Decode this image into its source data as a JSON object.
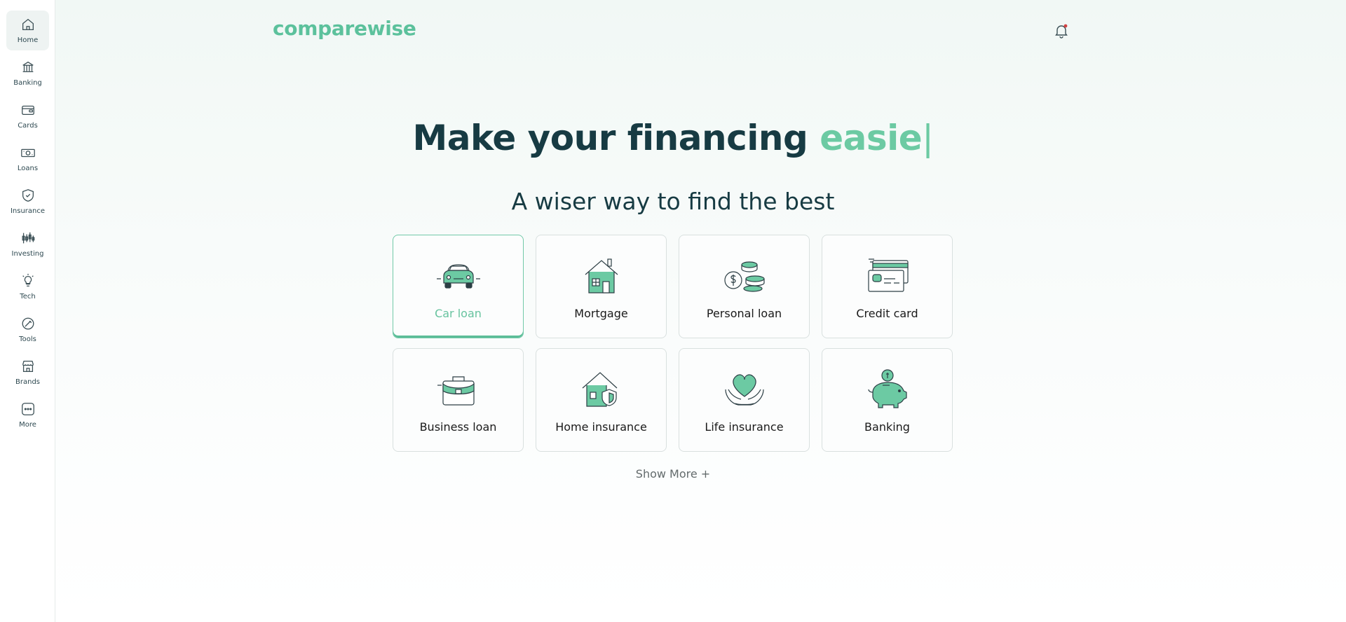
{
  "sidebar": {
    "items": [
      {
        "label": "Home",
        "icon": "home-icon",
        "active": true
      },
      {
        "label": "Banking",
        "icon": "bank-icon"
      },
      {
        "label": "Cards",
        "icon": "wallet-icon"
      },
      {
        "label": "Loans",
        "icon": "money-icon"
      },
      {
        "label": "Insurance",
        "icon": "shield-icon"
      },
      {
        "label": "Investing",
        "icon": "chart-icon"
      },
      {
        "label": "Tech",
        "icon": "lightbulb-icon"
      },
      {
        "label": "Tools",
        "icon": "tools-icon"
      },
      {
        "label": "Brands",
        "icon": "store-icon"
      },
      {
        "label": "More",
        "icon": "more-icon"
      }
    ]
  },
  "header": {
    "logo": "comparewise",
    "bell_icon": "bell-icon"
  },
  "hero": {
    "headline_main": "Make your financing",
    "headline_accent": "easie",
    "caret": "|",
    "subheadline": "A wiser way to find the best"
  },
  "categories": [
    {
      "label": "Car loan",
      "icon": "car-icon",
      "selected": true
    },
    {
      "label": "Mortgage",
      "icon": "house-icon"
    },
    {
      "label": "Personal loan",
      "icon": "coins-icon"
    },
    {
      "label": "Credit card",
      "icon": "credit-card-icon"
    },
    {
      "label": "Business loan",
      "icon": "briefcase-icon"
    },
    {
      "label": "Home insurance",
      "icon": "home-shield-icon"
    },
    {
      "label": "Life insurance",
      "icon": "heart-hands-icon"
    },
    {
      "label": "Banking",
      "icon": "piggy-bank-icon"
    }
  ],
  "show_more": "Show More +",
  "colors": {
    "accent": "#5cc19c",
    "heading": "#173b43",
    "card_border": "#d9e0df"
  }
}
